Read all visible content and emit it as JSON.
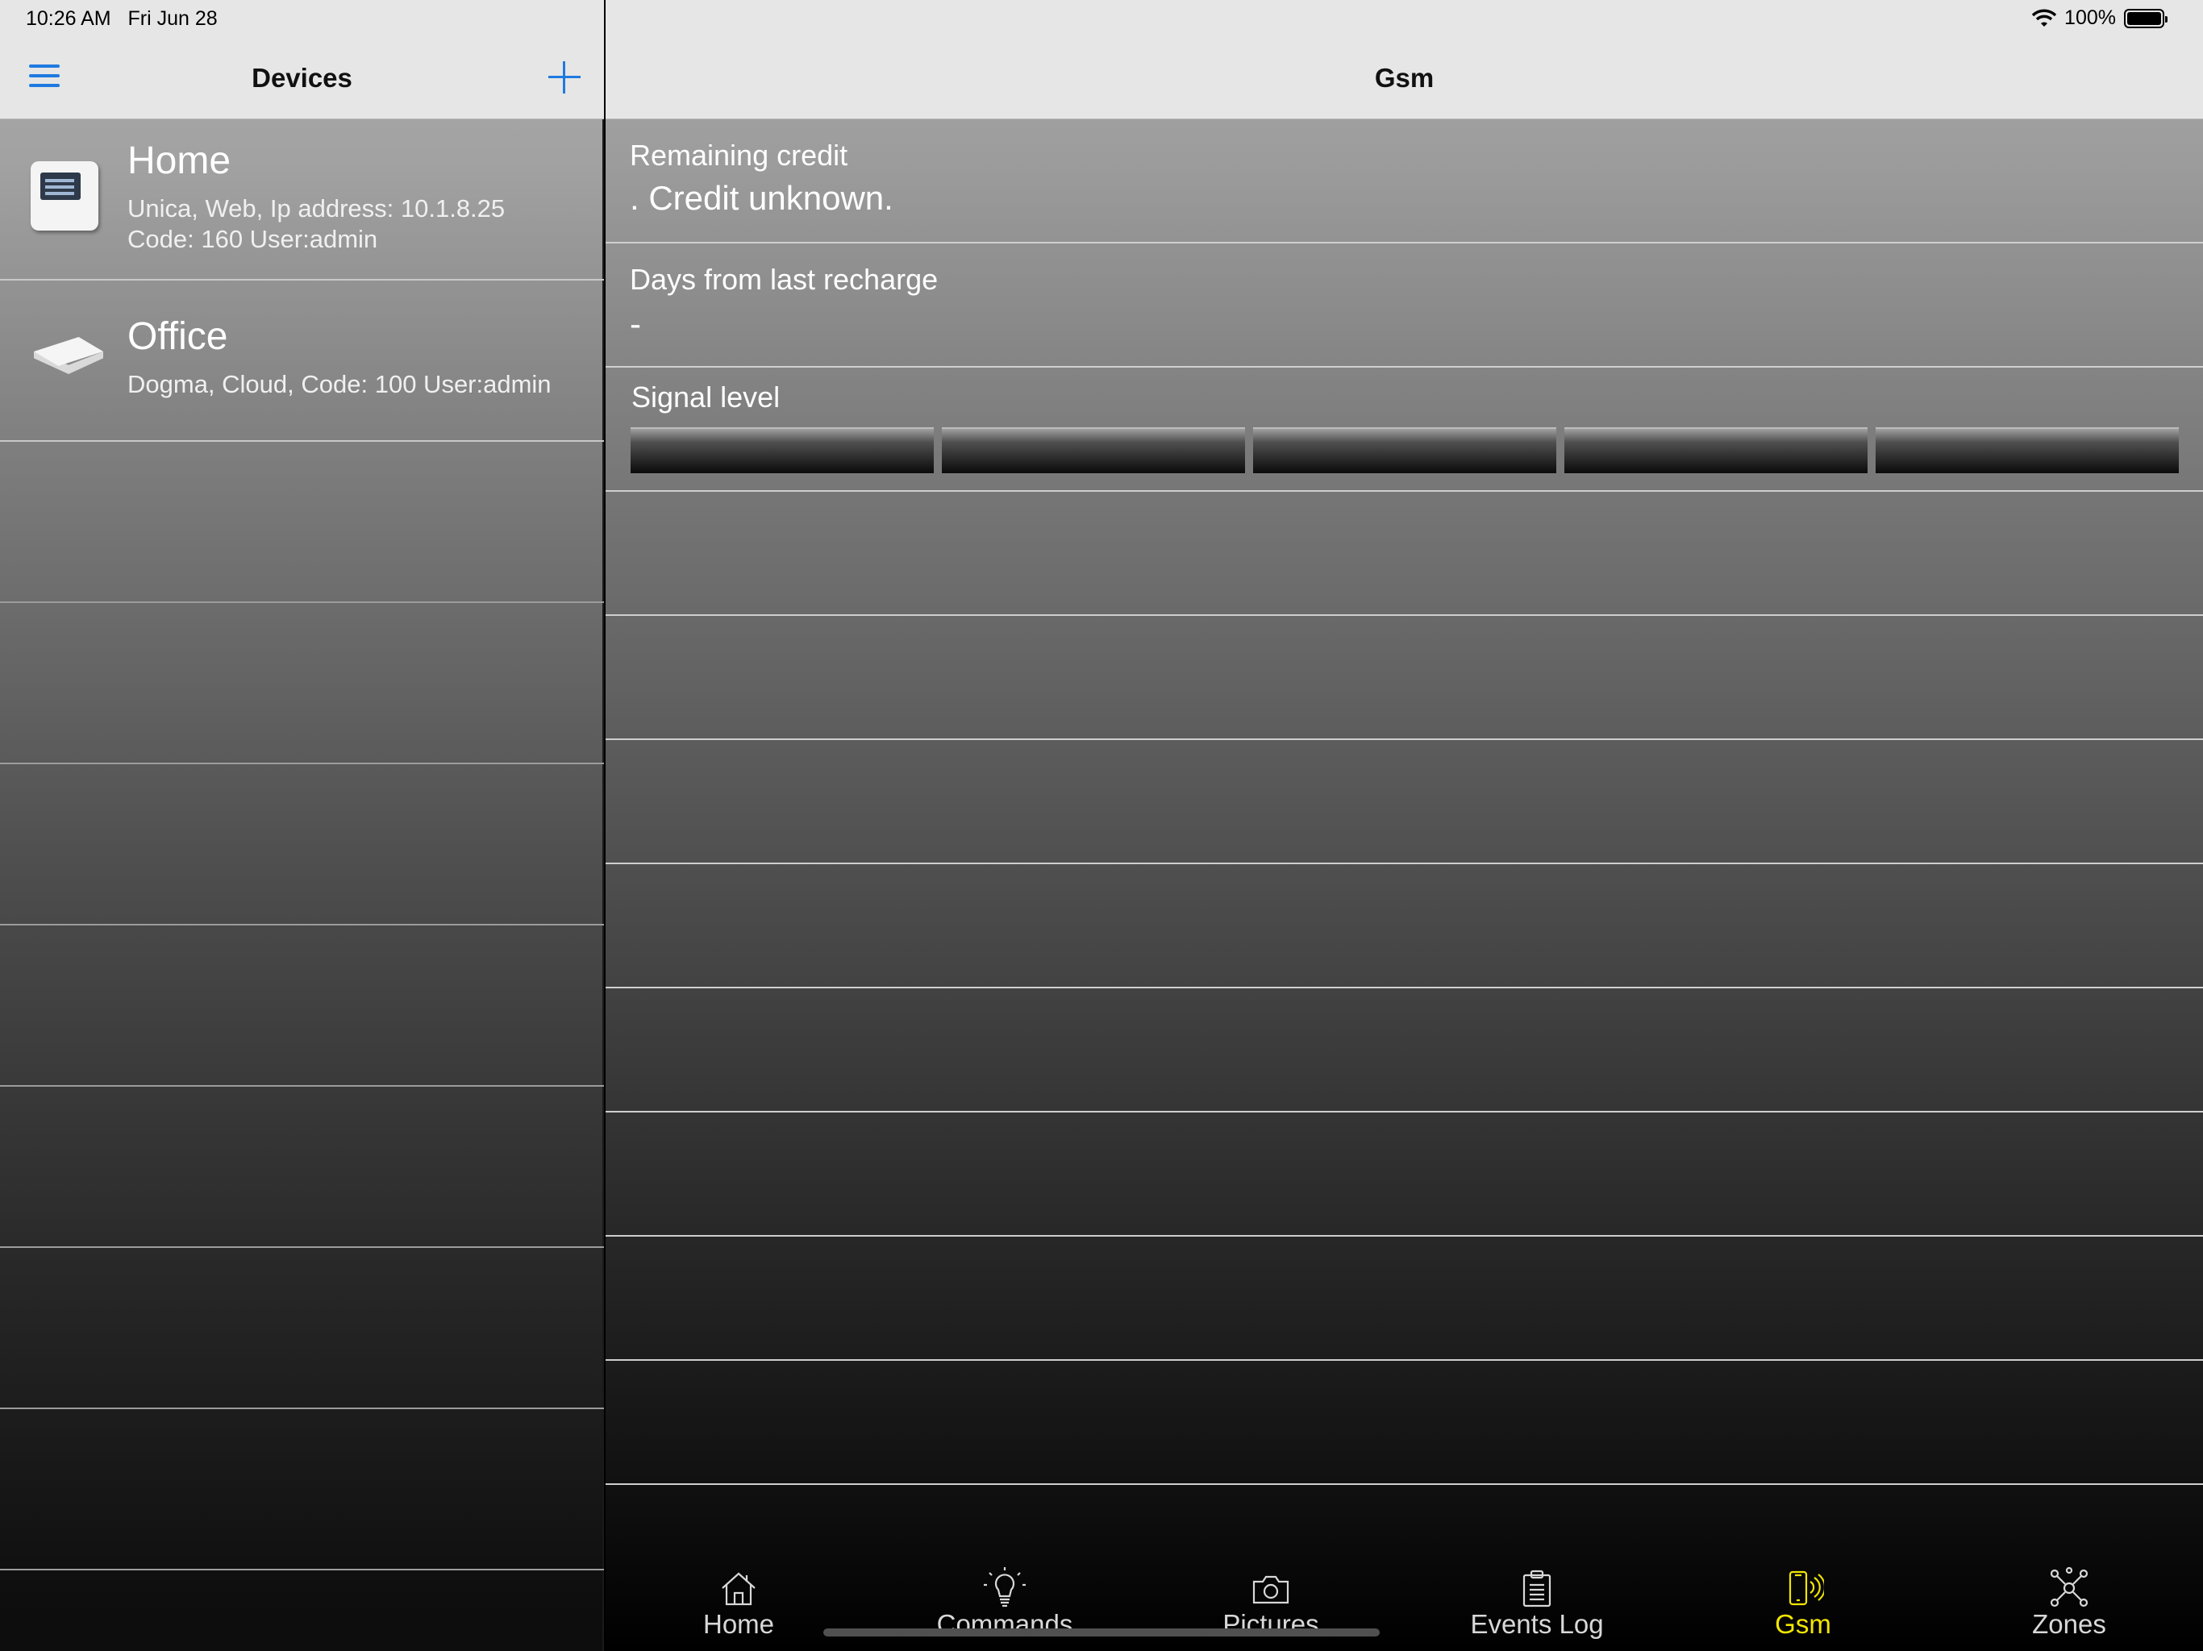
{
  "status_bar": {
    "time": "10:26 AM",
    "date": "Fri Jun 28",
    "battery": "100%"
  },
  "devices_panel": {
    "title": "Devices",
    "devices": [
      {
        "name": "Home",
        "line1": "Unica, Web, Ip address: 10.1.8.25",
        "line2": "Code: 160 User:admin",
        "icon": "unica-panel-icon"
      },
      {
        "name": "Office",
        "line1": "Dogma, Cloud, Code: 100 User:admin",
        "icon": "dogma-panel-icon"
      }
    ]
  },
  "gsm_panel": {
    "title": "Gsm",
    "remaining_credit": {
      "label": "Remaining credit",
      "value": ". Credit unknown."
    },
    "days_from_recharge": {
      "label": "Days from last recharge",
      "value": "-"
    },
    "signal": {
      "label": "Signal level",
      "bars_total": 5,
      "bars_active": 0
    }
  },
  "tab_bar": {
    "tabs": [
      {
        "label": "Home",
        "icon": "home-icon"
      },
      {
        "label": "Commands",
        "icon": "lightbulb-icon"
      },
      {
        "label": "Pictures",
        "icon": "camera-icon"
      },
      {
        "label": "Events Log",
        "icon": "clipboard-icon"
      },
      {
        "label": "Gsm",
        "icon": "phone-signal-icon",
        "active": true
      },
      {
        "label": "Zones",
        "icon": "zones-network-icon"
      }
    ],
    "active_color": "#f2e600",
    "inactive_color": "#d8d8d8"
  },
  "colors": {
    "accent": "#1f7ae0",
    "header_bg": "#e6e6e6"
  }
}
